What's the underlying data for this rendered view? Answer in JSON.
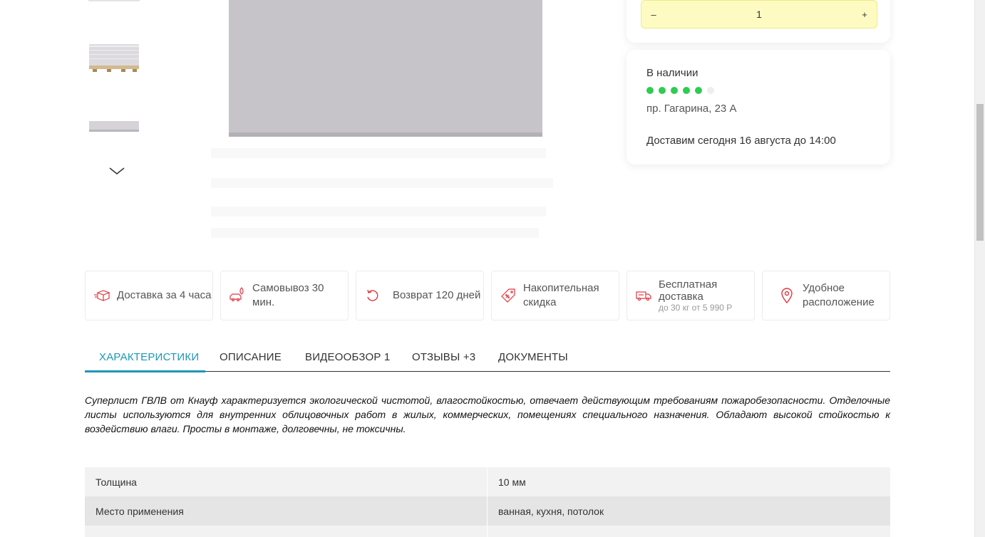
{
  "quantity": {
    "minus": "–",
    "value": "1",
    "plus": "+"
  },
  "stock": {
    "title": "В наличии",
    "rating_filled": 5,
    "rating_total": 6,
    "address": "пр. Гагарина, 23 А",
    "delivery": "Доставим сегодня 16 августа до 14:00"
  },
  "features": [
    {
      "icon": "box-icon",
      "label": "Доставка за 4 часа"
    },
    {
      "icon": "car-pin-icon",
      "label": "Самовывоз 30 мин."
    },
    {
      "icon": "return-icon",
      "label": "Возврат 120 дней"
    },
    {
      "icon": "discount-tag-icon",
      "label": "Накопительная скидка"
    },
    {
      "icon": "free-truck-icon",
      "label": "Бесплатная доставка",
      "sub": "до 30 кг от 5 990 Р"
    },
    {
      "icon": "location-pin-icon",
      "label": "Удобное расположение"
    }
  ],
  "tabs": [
    {
      "label": "ХАРАКТЕРИСТИКИ",
      "active": true
    },
    {
      "label": "ОПИСАНИЕ"
    },
    {
      "label": "ВИДЕООБЗОР 1"
    },
    {
      "label": "ОТЗЫВЫ +3"
    },
    {
      "label": "ДОКУМЕНТЫ"
    }
  ],
  "description": "Суперлист ГВЛВ от Кнауф характеризуется экологической чистотой, влагостойкостью, отвечает действующим требованиям пожаробезопасности. Отделочные листы используются для внутренних облицовочных работ в жилых, коммерческих, помещениях специального назначения. Обладают высокой стойкостью к воздействию влаги. Просты в монтаже, долговечны, не токсичны.",
  "specs": [
    {
      "key": "Толщина",
      "value": "10 мм"
    },
    {
      "key": "Место применения",
      "value": "ванная, кухня, потолок"
    }
  ],
  "colors": {
    "accent": "#1c97b7",
    "brand_red": "#e0373f",
    "in_stock_green": "#2ecc50",
    "qty_bg": "#fdfbc1"
  }
}
